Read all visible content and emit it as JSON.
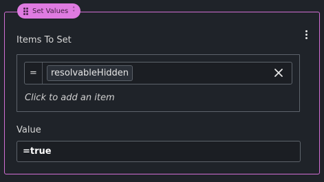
{
  "block": {
    "tag_label": "Set Values",
    "tag_color": "#df7be1",
    "border_color": "#d46fd6",
    "menu_icon": "kebab-vertical-icon"
  },
  "items_section": {
    "label": "Items To Set",
    "rows": [
      {
        "operator": "=",
        "value": "resolvableHidden",
        "clear_icon": "close-icon"
      }
    ],
    "add_hint": "Click to add an item"
  },
  "value_section": {
    "label": "Value",
    "value": "=true"
  }
}
